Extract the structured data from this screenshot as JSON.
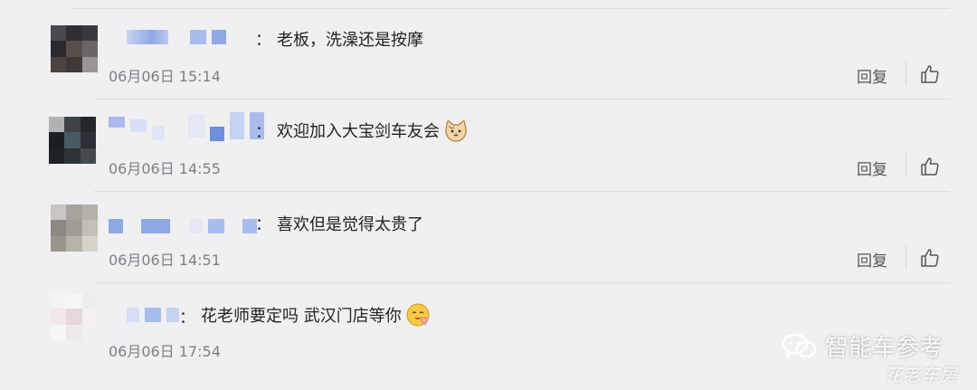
{
  "comments": [
    {
      "colon": "：",
      "text": "老板，洗澡还是按摩",
      "time": "06月06日 15:14",
      "reply_label": "回复",
      "has_emoji": false
    },
    {
      "colon": "：",
      "text": "欢迎加入大宝剑车友会",
      "time": "06月06日 14:55",
      "reply_label": "回复",
      "has_emoji": true,
      "emoji_icon": "cat-face-icon"
    },
    {
      "colon": "：",
      "text": "喜欢但是觉得太贵了",
      "time": "06月06日 14:51",
      "reply_label": "回复",
      "has_emoji": false
    },
    {
      "colon": "：",
      "text": "花老师要定吗 武汉门店等你",
      "time": "06月06日 17:54",
      "reply_label": "",
      "has_emoji": true,
      "emoji_icon": "hugging-face-icon"
    }
  ],
  "watermark": {
    "brand": "智能车参考",
    "sub": "花老车房",
    "icon": "wechat-icon"
  },
  "colors": {
    "background": "#f0f0f2",
    "time": "#7f7f84",
    "blur_blue": "#8fa8e6"
  }
}
